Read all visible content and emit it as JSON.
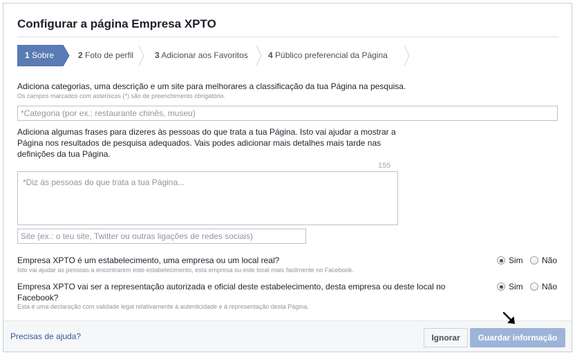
{
  "dialog": {
    "title": "Configurar a página Empresa XPTO"
  },
  "steps": [
    {
      "num": "1",
      "label": "Sobre",
      "active": true
    },
    {
      "num": "2",
      "label": "Foto de perfil",
      "active": false
    },
    {
      "num": "3",
      "label": "Adicionar aos Favoritos",
      "active": false
    },
    {
      "num": "4",
      "label": "Público preferencial da Página",
      "active": false
    }
  ],
  "about": {
    "intro": "Adiciona categorias, uma descrição e um site para melhorares a classificação da tua Página na pesquisa.",
    "required_note": "Os campos marcados com asteriscos (*) são de preenchimento obrigatório.",
    "category_placeholder": "*Categoria (por ex.: restaurante chinês, museu)",
    "description_intro": "Adiciona algumas frases para dizeres às pessoas do que trata a tua Página. Isto vai ajudar a mostrar a Página nos resultados de pesquisa adequados. Vais podes adicionar mais detalhes mais tarde nas definições da tua Página.",
    "char_counter": "155",
    "description_placeholder": "*Diz às pessoas do que trata a tua Página...",
    "website_placeholder": "Site (ex.: o teu site, Twitter ou outras ligações de redes sociais)"
  },
  "questions": [
    {
      "question": "Empresa XPTO é um estabelecimento, uma empresa ou um local real?",
      "hint": "Isto vai ajudar as pessoas a encontrarem este estabelecimento, esta empresa ou este local mais facilmente no Facebook.",
      "yes": "Sim",
      "no": "Não",
      "selected": "yes"
    },
    {
      "question": "Empresa XPTO vai ser a representação autorizada e oficial deste estabelecimento, desta empresa ou deste local no Facebook?",
      "hint": "Esta é uma declaração com validade legal relativamente à autenticidade e à representação desta Página.",
      "yes": "Sim",
      "no": "Não",
      "selected": "yes"
    }
  ],
  "footer": {
    "help_link": "Precisas de ajuda?",
    "ignore_button": "Ignorar",
    "save_button": "Guardar informação"
  },
  "colors": {
    "accent": "#4267b2",
    "active_step": "#5b7bb4",
    "save_disabled": "#9cb4d8",
    "link": "#365899"
  }
}
